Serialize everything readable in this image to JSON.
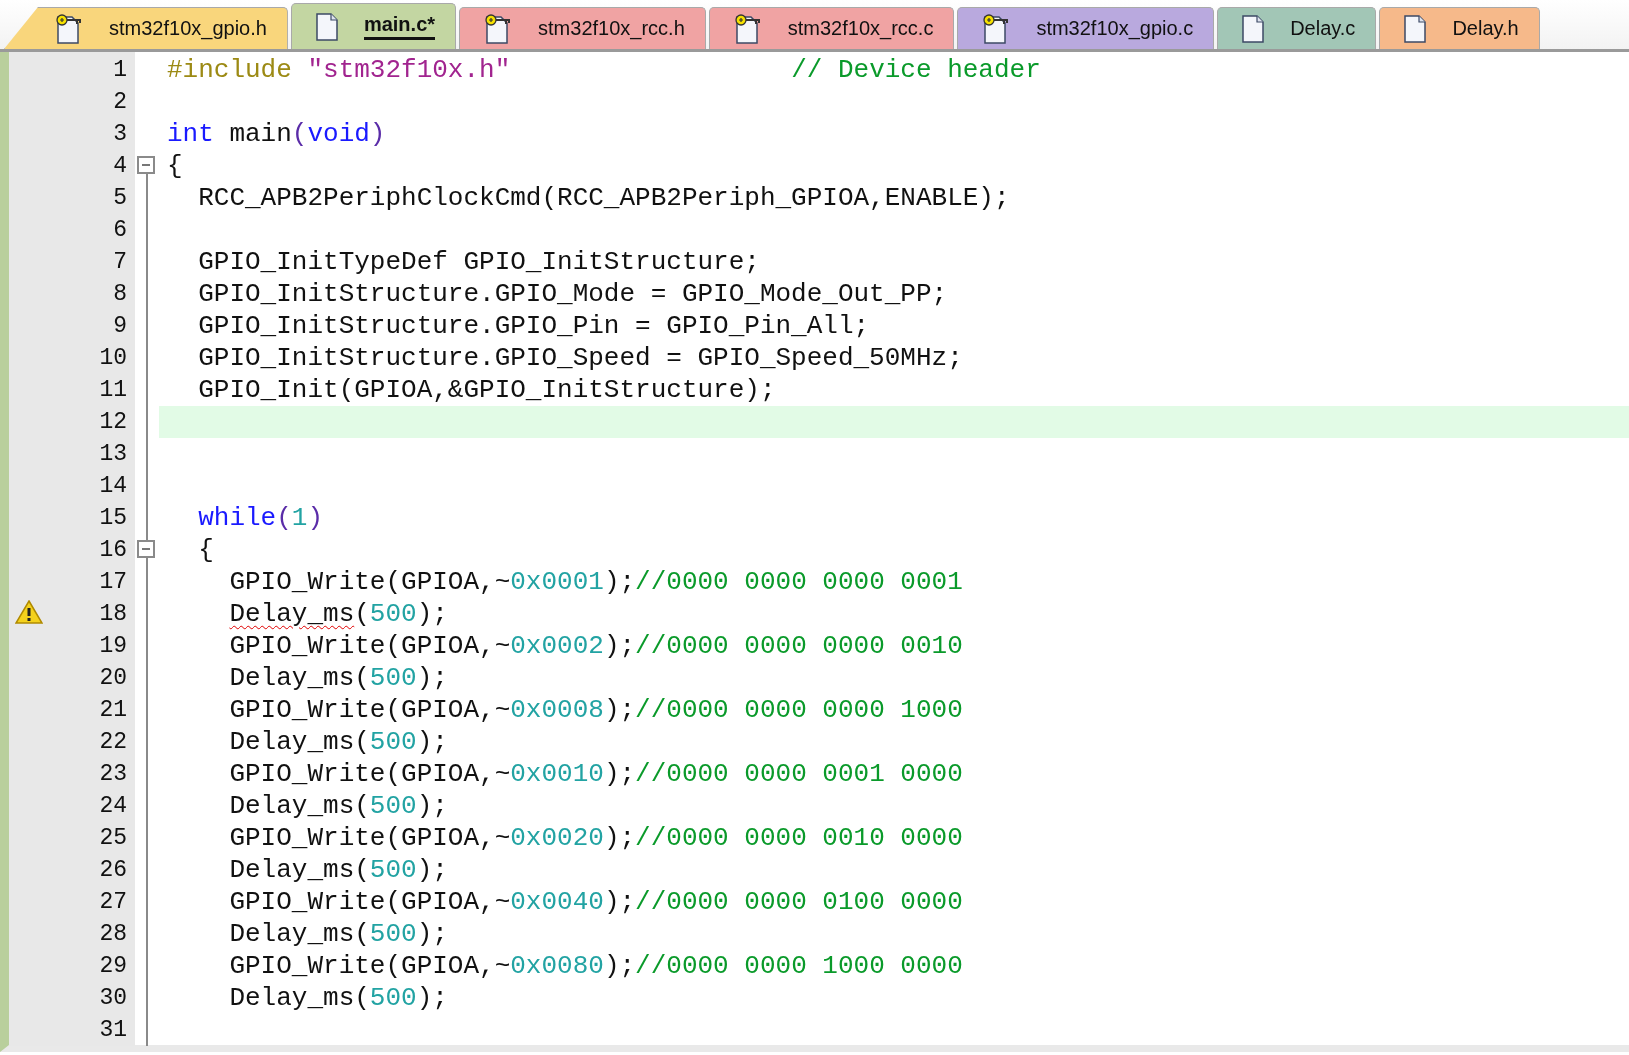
{
  "tabs": [
    {
      "label": "stm32f10x_gpio.h",
      "kind": "library",
      "color": "#f9d67c",
      "selected": false
    },
    {
      "label": "main.c*",
      "kind": "user",
      "color": "#c3d6a2",
      "selected": true
    },
    {
      "label": "stm32f10x_rcc.h",
      "kind": "library",
      "color": "#f0a3a3",
      "selected": false
    },
    {
      "label": "stm32f10x_rcc.c",
      "kind": "library",
      "color": "#f0a3a3",
      "selected": false
    },
    {
      "label": "stm32f10x_gpio.c",
      "kind": "library",
      "color": "#b9a9de",
      "selected": false
    },
    {
      "label": "Delay.c",
      "kind": "user",
      "color": "#a2c6b6",
      "selected": false
    },
    {
      "label": "Delay.h",
      "kind": "user",
      "color": "#f6b98a",
      "selected": false
    }
  ],
  "editor": {
    "lines": [
      {
        "number": "1",
        "tokens": [
          {
            "kind": "preproc",
            "text": "#include"
          },
          {
            "kind": "string",
            "text": " \"stm32f10x.h\""
          },
          {
            "kind": "aligned-comment",
            "text": "// Device header"
          }
        ]
      },
      {
        "number": "2"
      },
      {
        "number": "3",
        "tokens": [
          {
            "kind": "keyword",
            "text": "int"
          },
          {
            "kind": "plain",
            "text": " main"
          },
          {
            "kind": "paren",
            "text": "("
          },
          {
            "kind": "keyword",
            "text": "void"
          },
          {
            "kind": "paren",
            "text": ")"
          }
        ]
      },
      {
        "number": "4",
        "fold": {
          "expanded": true
        },
        "tokens": [
          {
            "kind": "plain",
            "text": "{"
          }
        ]
      },
      {
        "number": "5",
        "tokens": [
          {
            "kind": "plain",
            "text": "  RCC_APB2PeriphClockCmd(RCC_APB2Periph_GPIOA,ENABLE);"
          }
        ]
      },
      {
        "number": "6"
      },
      {
        "number": "7",
        "tokens": [
          {
            "kind": "plain",
            "text": "  GPIO_InitTypeDef GPIO_InitStructure;"
          }
        ]
      },
      {
        "number": "8",
        "tokens": [
          {
            "kind": "plain",
            "text": "  GPIO_InitStructure.GPIO_Mode = GPIO_Mode_Out_PP;"
          }
        ]
      },
      {
        "number": "9",
        "tokens": [
          {
            "kind": "plain",
            "text": "  GPIO_InitStructure.GPIO_Pin = GPIO_Pin_All;"
          }
        ]
      },
      {
        "number": "10",
        "tokens": [
          {
            "kind": "plain",
            "text": "  GPIO_InitStructure.GPIO_Speed = GPIO_Speed_50MHz;"
          }
        ]
      },
      {
        "number": "11",
        "tokens": [
          {
            "kind": "plain",
            "text": "  GPIO_Init(GPIOA,&GPIO_InitStructure);"
          }
        ]
      },
      {
        "number": "12",
        "current": true
      },
      {
        "number": "13"
      },
      {
        "number": "14"
      },
      {
        "number": "15",
        "tokens": [
          {
            "kind": "keyword",
            "text": "  while"
          },
          {
            "kind": "paren",
            "text": "("
          },
          {
            "kind": "number",
            "text": "1"
          },
          {
            "kind": "paren",
            "text": ")"
          }
        ]
      },
      {
        "number": "16",
        "fold": {
          "expanded": true
        },
        "tokens": [
          {
            "kind": "plain",
            "text": "  {"
          }
        ]
      },
      {
        "number": "17",
        "tokens": [
          {
            "kind": "plain",
            "text": "    GPIO_Write(GPIOA,~"
          },
          {
            "kind": "number",
            "text": "0x0001"
          },
          {
            "kind": "plain",
            "text": ");"
          },
          {
            "kind": "comment",
            "text": "//0000 0000 0000 0001"
          }
        ]
      },
      {
        "number": "18",
        "warning": true,
        "tokens": [
          {
            "kind": "plain",
            "text": "    Delay_ms",
            "squiggle": true
          },
          {
            "kind": "plain",
            "text": "("
          },
          {
            "kind": "number",
            "text": "500"
          },
          {
            "kind": "plain",
            "text": ");"
          }
        ]
      },
      {
        "number": "19",
        "tokens": [
          {
            "kind": "plain",
            "text": "    GPIO_Write(GPIOA,~"
          },
          {
            "kind": "number",
            "text": "0x0002"
          },
          {
            "kind": "plain",
            "text": ");"
          },
          {
            "kind": "comment",
            "text": "//0000 0000 0000 0010"
          }
        ]
      },
      {
        "number": "20",
        "tokens": [
          {
            "kind": "plain",
            "text": "    Delay_ms("
          },
          {
            "kind": "number",
            "text": "500"
          },
          {
            "kind": "plain",
            "text": ");"
          }
        ]
      },
      {
        "number": "21",
        "tokens": [
          {
            "kind": "plain",
            "text": "    GPIO_Write(GPIOA,~"
          },
          {
            "kind": "number",
            "text": "0x0008"
          },
          {
            "kind": "plain",
            "text": ");"
          },
          {
            "kind": "comment",
            "text": "//0000 0000 0000 1000"
          }
        ]
      },
      {
        "number": "22",
        "tokens": [
          {
            "kind": "plain",
            "text": "    Delay_ms("
          },
          {
            "kind": "number",
            "text": "500"
          },
          {
            "kind": "plain",
            "text": ");"
          }
        ]
      },
      {
        "number": "23",
        "tokens": [
          {
            "kind": "plain",
            "text": "    GPIO_Write(GPIOA,~"
          },
          {
            "kind": "number",
            "text": "0x0010"
          },
          {
            "kind": "plain",
            "text": ");"
          },
          {
            "kind": "comment",
            "text": "//0000 0000 0001 0000"
          }
        ]
      },
      {
        "number": "24",
        "tokens": [
          {
            "kind": "plain",
            "text": "    Delay_ms("
          },
          {
            "kind": "number",
            "text": "500"
          },
          {
            "kind": "plain",
            "text": ");"
          }
        ]
      },
      {
        "number": "25",
        "tokens": [
          {
            "kind": "plain",
            "text": "    GPIO_Write(GPIOA,~"
          },
          {
            "kind": "number",
            "text": "0x0020"
          },
          {
            "kind": "plain",
            "text": ");"
          },
          {
            "kind": "comment",
            "text": "//0000 0000 0010 0000"
          }
        ]
      },
      {
        "number": "26",
        "tokens": [
          {
            "kind": "plain",
            "text": "    Delay_ms("
          },
          {
            "kind": "number",
            "text": "500"
          },
          {
            "kind": "plain",
            "text": ");"
          }
        ]
      },
      {
        "number": "27",
        "tokens": [
          {
            "kind": "plain",
            "text": "    GPIO_Write(GPIOA,~"
          },
          {
            "kind": "number",
            "text": "0x0040"
          },
          {
            "kind": "plain",
            "text": ");"
          },
          {
            "kind": "comment",
            "text": "//0000 0000 0100 0000"
          }
        ]
      },
      {
        "number": "28",
        "tokens": [
          {
            "kind": "plain",
            "text": "    Delay_ms("
          },
          {
            "kind": "number",
            "text": "500"
          },
          {
            "kind": "plain",
            "text": ");"
          }
        ]
      },
      {
        "number": "29",
        "tokens": [
          {
            "kind": "plain",
            "text": "    GPIO_Write(GPIOA,~"
          },
          {
            "kind": "number",
            "text": "0x0080"
          },
          {
            "kind": "plain",
            "text": ");"
          },
          {
            "kind": "comment",
            "text": "//0000 0000 1000 0000"
          }
        ]
      },
      {
        "number": "30",
        "tokens": [
          {
            "kind": "plain",
            "text": "    Delay_ms("
          },
          {
            "kind": "number",
            "text": "500"
          },
          {
            "kind": "plain",
            "text": ");"
          }
        ]
      },
      {
        "number": "31"
      }
    ]
  }
}
